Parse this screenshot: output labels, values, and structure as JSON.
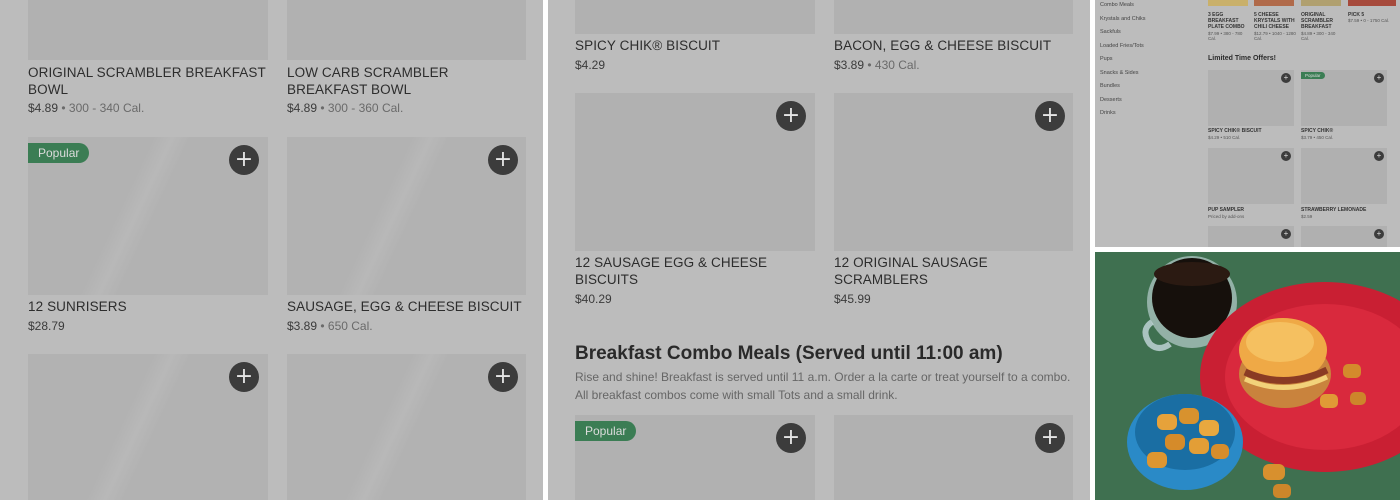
{
  "panel1": {
    "top_items": [
      {
        "name": "ORIGINAL SCRAMBLER BREAKFAST BOWL",
        "price": "$4.89",
        "cal": " • 300 - 340 Cal."
      },
      {
        "name": "LOW CARB SCRAMBLER BREAKFAST BOWL",
        "price": "$4.89",
        "cal": " • 300 - 360 Cal."
      }
    ],
    "mid_items": [
      {
        "name": "12 SUNRISERS",
        "price": "$28.79",
        "cal": "",
        "badge": "Popular"
      },
      {
        "name": "SAUSAGE, EGG & CHEESE BISCUIT",
        "price": "$3.89",
        "cal": " • 650 Cal."
      }
    ]
  },
  "panel2": {
    "top_items": [
      {
        "name": "SPICY CHIK® BISCUIT",
        "price": "$4.29",
        "cal": ""
      },
      {
        "name": "BACON, EGG & CHEESE BISCUIT",
        "price": "$3.89",
        "cal": " • 430 Cal."
      }
    ],
    "mid_items": [
      {
        "name": "12 SAUSAGE EGG & CHEESE BISCUITS",
        "price": "$40.29",
        "cal": ""
      },
      {
        "name": "12 ORIGINAL SAUSAGE SCRAMBLERS",
        "price": "$45.99",
        "cal": ""
      }
    ],
    "section": {
      "title": "Breakfast Combo Meals (Served until 11:00 am)",
      "desc": "Rise and shine! Breakfast is served until 11 a.m. Order a la carte or treat yourself to a combo. All breakfast combos come with small Tots and a small drink."
    },
    "bottom_badge": "Popular"
  },
  "panel3": {
    "sidebar": [
      "Combo Meals",
      "Krystals and Chiks",
      "Sackfuls",
      "Loaded Fries/Tots",
      "Pups",
      "Snacks & Sides",
      "Bundles",
      "Desserts",
      "Drinks"
    ],
    "top_names": [
      {
        "name": "3 EGG BREAKFAST PLATE COMBO",
        "price": "$7.99 • 380 - 780 Cal."
      },
      {
        "name": "5 CHEESE KRYSTALS WITH CHILI CHEESE",
        "price": "$12.79 • 1040 - 1280 Cal."
      },
      {
        "name": "ORIGINAL SCRAMBLER BREAKFAST",
        "price": "$4.89 • 300 - 340 Cal."
      },
      {
        "name": "PICK 5",
        "price": "$7.59 • 0 - 1750 Cal."
      }
    ],
    "section_title": "Limited Time Offers!",
    "badge": "Popular",
    "items": [
      {
        "name": "SPICY CHIK® BISCUIT",
        "price": "$4.29 • 510 Cal."
      },
      {
        "name": "SPICY CHIK®",
        "price": "$3.79 • 450 Cal."
      },
      {
        "name": "PUP SAMPLER",
        "price": "Priced by add-ons"
      },
      {
        "name": "STRAWBERRY LEMONADE",
        "price": "$2.59"
      }
    ]
  },
  "plus_symbol": "+",
  "colors": {
    "panel_bg": "#bcbcbc",
    "badge_green": "#3b7d54",
    "photo_bg": "#3f7050",
    "plate": "#d62839",
    "bowl": "#2a8ac7"
  }
}
